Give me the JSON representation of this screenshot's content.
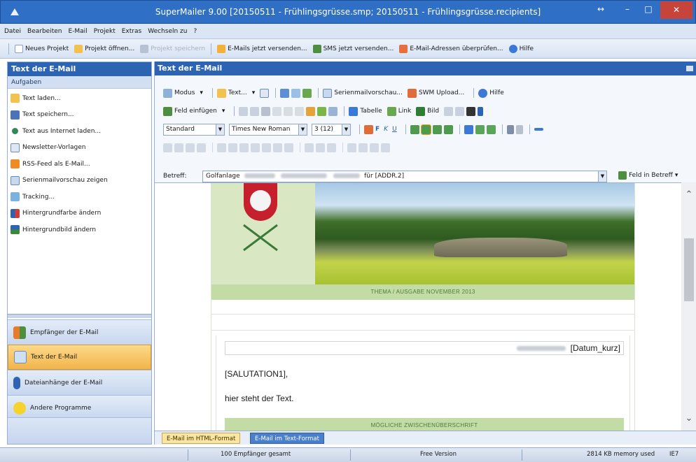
{
  "window": {
    "title": "SuperMailer 9.00 [20150511 - Frühlingsgrüsse.smp; 20150511 - Frühlingsgrüsse.recipients]",
    "controls": {
      "restore": "↔",
      "minimize": "–",
      "maximize": "□",
      "close": "✕"
    }
  },
  "menu": [
    "Datei",
    "Bearbeiten",
    "E-Mail",
    "Projekt",
    "Extras",
    "Wechseln zu",
    "?"
  ],
  "toolbar": {
    "new_project": "Neues Projekt",
    "open_project": "Projekt öffnen...",
    "save_project": "Projekt speichern",
    "send_emails": "E-Mails jetzt versenden...",
    "send_sms": "SMS jetzt versenden...",
    "check_addresses": "E-Mail-Adressen überprüfen...",
    "help": "Hilfe"
  },
  "left_pane": {
    "title": "Text der E-Mail",
    "tasks_header": "Aufgaben",
    "tasks": [
      "Text laden...",
      "Text speichern...",
      "Text aus Internet laden...",
      "Newsletter-Vorlagen",
      "RSS-Feed als E-Mail...",
      "Serienmailvorschau zeigen",
      "Tracking...",
      "Hintergrundfarbe ändern",
      "Hintergrundbild ändern"
    ],
    "nav": [
      "Empfänger der E-Mail",
      "Text der E-Mail",
      "Dateianhänge der E-Mail",
      "Andere Programme"
    ]
  },
  "right_pane": {
    "title": "Text der E-Mail",
    "toolbar1": {
      "mode": "Modus",
      "text": "Text...",
      "preview": "Serienmailvorschau...",
      "swm_upload": "SWM Upload...",
      "help": "Hilfe"
    },
    "toolbar2": {
      "insert_field": "Feld einfügen",
      "table": "Tabelle",
      "link": "Link",
      "image": "Bild"
    },
    "format": {
      "style": "Standard",
      "font": "Times New Roman",
      "size": "3 (12)",
      "bold": "F",
      "italic": "K",
      "underline": "U"
    },
    "subject": {
      "label": "Betreff:",
      "value_prefix": "Golfanlage",
      "value_suffix": "für [ADDR.2]",
      "field_button": "Feld in Betreff"
    }
  },
  "email": {
    "thema": "THEMA / AUSGABE NOVEMBER 2013",
    "date_placeholder": "[Datum_kurz]",
    "salutation": "[SALUTATION1],",
    "body": "hier steht der Text.",
    "subheading": "MÖGLICHE ZWISCHENÜBERSCHRIFT"
  },
  "tabs": {
    "html": "E-Mail im HTML-Format",
    "text": "E-Mail im Text-Format"
  },
  "status": {
    "recipients": "100 Empfänger gesamt",
    "version": "Free Version",
    "memory": "2814 KB memory used",
    "browser": "IE7"
  }
}
